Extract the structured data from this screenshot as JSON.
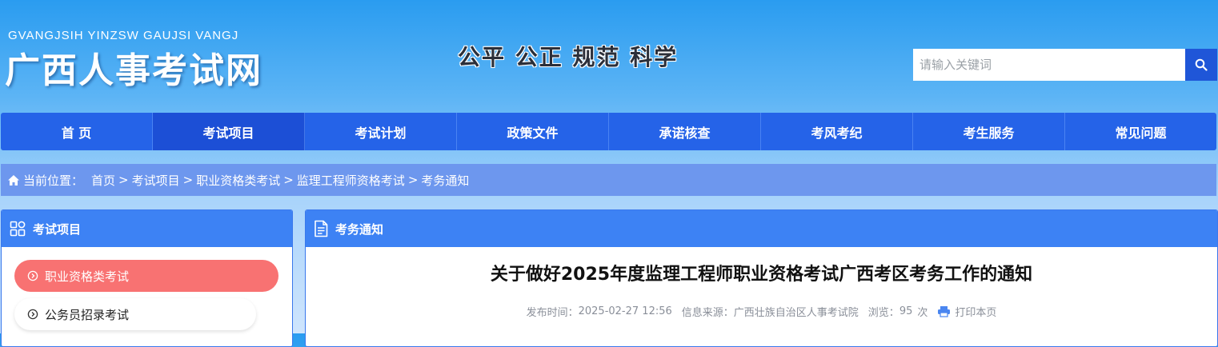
{
  "header": {
    "brand_pinyin": "GVANGJSIH YINZSW GAUJSI VANGJ",
    "brand_name": "广西人事考试网",
    "slogan": "公平 公正 规范 科学"
  },
  "search": {
    "placeholder": "请输入关键词",
    "value": "",
    "button_icon": "search-icon"
  },
  "nav": {
    "items": [
      {
        "label": "首 页"
      },
      {
        "label": "考试项目"
      },
      {
        "label": "考试计划"
      },
      {
        "label": "政策文件"
      },
      {
        "label": "承诺核查"
      },
      {
        "label": "考风考纪"
      },
      {
        "label": "考生服务"
      },
      {
        "label": "常见问题"
      }
    ],
    "active_index": 1
  },
  "breadcrumb": {
    "prefix": "当前位置：",
    "items": [
      "首页",
      "考试项目",
      "职业资格类考试",
      "监理工程师资格考试",
      "考务通知"
    ],
    "separator": ">"
  },
  "sidebar": {
    "title": "考试项目",
    "items": [
      {
        "label": "职业资格类考试",
        "active": true
      },
      {
        "label": "公务员招录考试",
        "active": false
      }
    ]
  },
  "main": {
    "section_title": "考务通知",
    "article": {
      "title": "关于做好2025年度监理工程师职业资格考试广西考区考务工作的通知",
      "publish_label": "发布时间：",
      "publish_time": "2025-02-27 12:56",
      "source_label": "信息来源：",
      "source": "广西壮族自治区人事考试院",
      "views_label": "浏览：",
      "views": "95",
      "views_unit": "次",
      "print_label": "打印本页"
    }
  },
  "colors": {
    "nav_bg": "#2563e8",
    "nav_active": "#1c4fd6",
    "panel_head": "#3d82f4",
    "menu_active": "#f87272",
    "breadcrumb_bg": "#6d97ee"
  }
}
